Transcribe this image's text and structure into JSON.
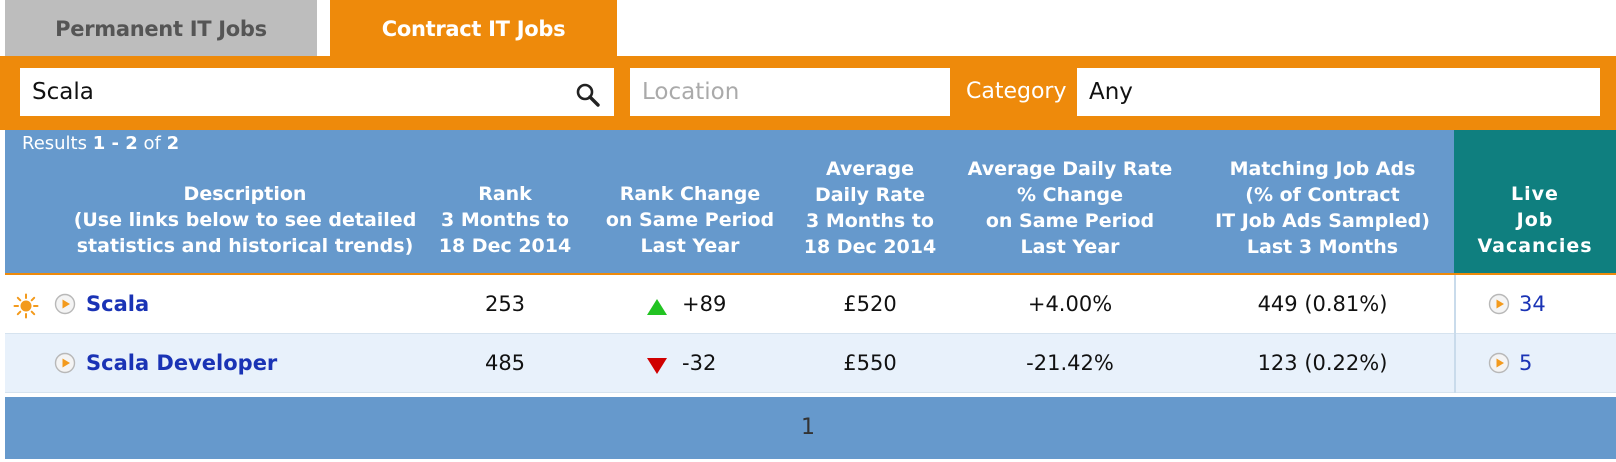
{
  "tabs": {
    "permanent": "Permanent IT Jobs",
    "contract": "Contract IT Jobs"
  },
  "search": {
    "keyword_value": "Scala",
    "location_placeholder": "Location",
    "category_label": "Category",
    "category_value": "Any"
  },
  "results": {
    "prefix": "Results",
    "range": "1 - 2",
    "of": "of",
    "total": "2"
  },
  "columns": {
    "description": [
      "Description",
      "(Use links below to see detailed",
      "statistics and historical trends)"
    ],
    "rank": [
      "Rank",
      "3 Months to",
      "18 Dec 2014"
    ],
    "rank_change": [
      "Rank Change",
      "on Same Period",
      "Last Year"
    ],
    "avg_rate": [
      "Average",
      "Daily Rate",
      "3 Months to",
      "18 Dec 2014"
    ],
    "rate_change": [
      "Average Daily Rate",
      "% Change",
      "on Same Period",
      "Last Year"
    ],
    "matching": [
      "Matching Job Ads",
      "(% of Contract",
      "IT Job Ads Sampled)",
      "Last 3 Months"
    ],
    "live": [
      "Live",
      "Job",
      "Vacancies"
    ]
  },
  "rows": [
    {
      "description": "Scala",
      "rank": "253",
      "rank_change": "+89",
      "rank_change_direction": "up",
      "avg_rate": "£520",
      "rate_change": "+4.00%",
      "matching": "449 (0.81%)",
      "live": "34"
    },
    {
      "description": "Scala Developer",
      "rank": "485",
      "rank_change": "-32",
      "rank_change_direction": "down",
      "avg_rate": "£550",
      "rate_change": "-21.42%",
      "matching": "123 (0.22%)",
      "live": "5"
    }
  ],
  "pager": {
    "current_page": "1"
  },
  "colors": {
    "orange": "#ee8a0b",
    "header_blue": "#6699cc",
    "live_teal": "#0f7f7f",
    "link_blue": "#1a33b5",
    "up_green": "#22c322",
    "down_red": "#d00000"
  },
  "icons": [
    "search-icon",
    "sun-icon",
    "play-circle-icon",
    "triangle-up-icon",
    "triangle-down-icon"
  ]
}
